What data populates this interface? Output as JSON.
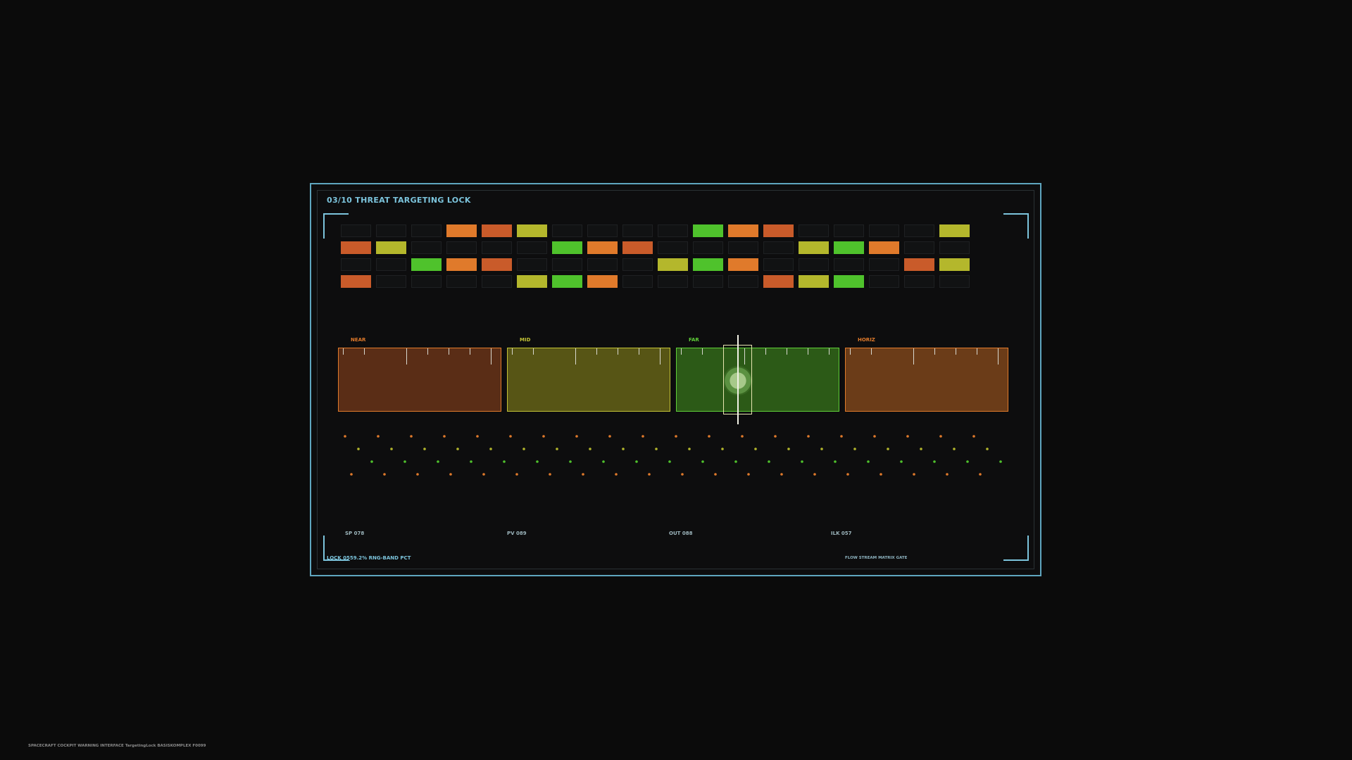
{
  "title": "03/10  THREAT TARGETING LOCK",
  "colors": {
    "frame": "#5fa6bf",
    "accent": "#7cc4dc",
    "orange": "#e07a2b",
    "rust": "#c95b2a",
    "yellow": "#b4b72c",
    "green": "#4fc22c"
  },
  "grid": {
    "rows": [
      [
        "",
        "",
        "",
        "orange",
        "rust",
        "yellow",
        "",
        "",
        "",
        "",
        "green",
        "orange",
        "rust",
        "",
        "",
        "",
        "",
        "yellow"
      ],
      [
        "rust",
        "yellow",
        "",
        "",
        "",
        "",
        "green",
        "orange",
        "rust",
        "",
        "",
        "",
        "",
        "yellow",
        "green",
        "orange",
        "",
        ""
      ],
      [
        "",
        "",
        "green",
        "orange",
        "rust",
        "",
        "",
        "",
        "",
        "yellow",
        "green",
        "orange",
        "",
        "",
        "",
        "",
        "rust",
        "yellow"
      ],
      [
        "rust",
        "",
        "",
        "",
        "",
        "yellow",
        "green",
        "orange",
        "",
        "",
        "",
        "",
        "rust",
        "yellow",
        "green",
        "",
        "",
        ""
      ]
    ]
  },
  "bands": [
    {
      "label": "NEAR",
      "fill": "#5a2d16",
      "border": "#e07a2b",
      "label_color": "#e07a2b"
    },
    {
      "label": "MID",
      "fill": "#575515",
      "border": "#c2c236",
      "label_color": "#c2c236"
    },
    {
      "label": "FAR",
      "fill": "#2c5a17",
      "border": "#5fcf38",
      "label_color": "#5fcf38"
    },
    {
      "label": "HORIZ",
      "fill": "#6b3c18",
      "border": "#e07a2b",
      "label_color": "#e07a2b"
    }
  ],
  "readouts": [
    {
      "label": "SP 078"
    },
    {
      "label": "PV 089"
    },
    {
      "label": "OUT 088"
    },
    {
      "label": "ILK 057"
    }
  ],
  "lock_label": "LOCK 05",
  "lock_value": "59.2%",
  "lock_suffix": "RNG-BAND PCT",
  "gate_text": "FLOW STREAM  MATRIX GATE",
  "footer": "SPACECRAFT COCKPIT WARNING INTERFACE  TargetingLock  BASISKOMPLEX  F0099"
}
